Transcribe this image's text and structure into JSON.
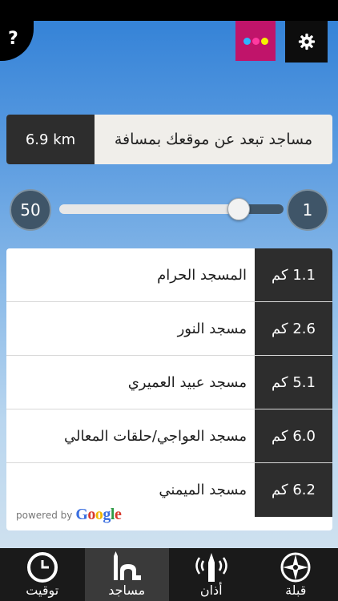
{
  "header": {
    "help_label": "?",
    "theme_dots": [
      "#2fb3ff",
      "#ff3aa0",
      "#f4f400"
    ]
  },
  "distance_panel": {
    "value": "6.9 km",
    "label": "مساجد تبعد عن موقعك بمسافة"
  },
  "slider": {
    "min_label": "1",
    "max_label": "50",
    "fraction_from_min": 0.2
  },
  "mosques": [
    {
      "name": "المسجد الحرام",
      "distance": "1.1 كم"
    },
    {
      "name": "مسجد النور",
      "distance": "2.6 كم"
    },
    {
      "name": "مسجد عبيد العميري",
      "distance": "5.1 كم"
    },
    {
      "name": "مسجد العواجي/حلقات المعالي",
      "distance": "6.0 كم"
    },
    {
      "name": "مسجد الميمني",
      "distance": "6.2 كم"
    }
  ],
  "attribution": {
    "prefix": "powered by",
    "brand": "Google"
  },
  "tabs": [
    {
      "label": "توقيت",
      "icon": "clock-icon"
    },
    {
      "label": "مساجد",
      "icon": "mosque-icon",
      "active": true
    },
    {
      "label": "أذان",
      "icon": "minaret-broadcast-icon"
    },
    {
      "label": "قبلة",
      "icon": "compass-icon"
    }
  ]
}
